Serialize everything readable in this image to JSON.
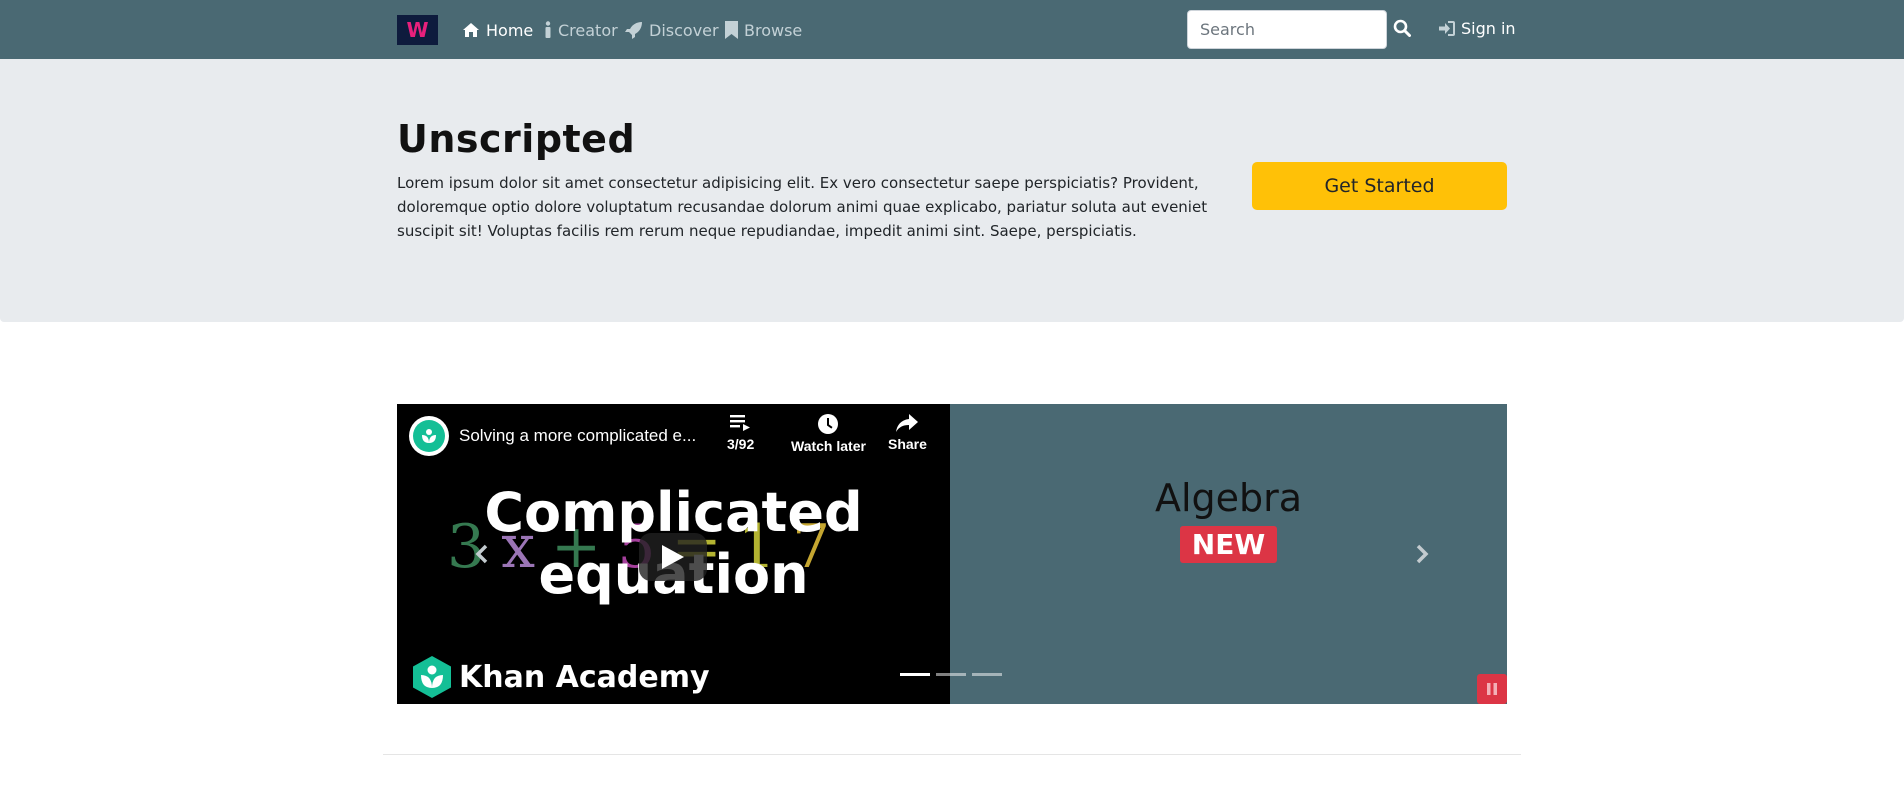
{
  "navbar": {
    "brand_letter": "W",
    "items": [
      {
        "label": "Home",
        "icon": "home-icon"
      },
      {
        "label": "Creator",
        "icon": "info-icon"
      },
      {
        "label": "Discover",
        "icon": "rocket-icon"
      },
      {
        "label": "Browse",
        "icon": "bookmark-icon"
      }
    ],
    "search_placeholder": "Search",
    "signin_label": "Sign in",
    "bg_color": "#4a6973"
  },
  "jumbotron": {
    "title": "Unscripted",
    "text": "Lorem ipsum dolor sit amet consectetur adipisicing elit. Ex vero consectetur saepe perspiciatis? Provident, doloremque optio dolore voluptatum recusandae dolorum animi quae explicabo, pariatur soluta aut eveniet suscipit sit! Voluptas facilis rem rerum neque repudiandae, impedit animi sint. Saepe, perspiciatis.",
    "cta_label": "Get Started",
    "cta_color": "#ffc107"
  },
  "carousel": {
    "video": {
      "title": "Solving a more complicated e...",
      "playlist_count": "3/92",
      "watch_later_label": "Watch later",
      "share_label": "Share",
      "thumbnail_title_line1": "Complicated",
      "thumbnail_title_line2": "equation",
      "channel_name": "Khan Academy"
    },
    "slide": {
      "heading": "Algebra",
      "badge": "NEW"
    },
    "indicator_count": 3,
    "active_indicator": 0
  }
}
